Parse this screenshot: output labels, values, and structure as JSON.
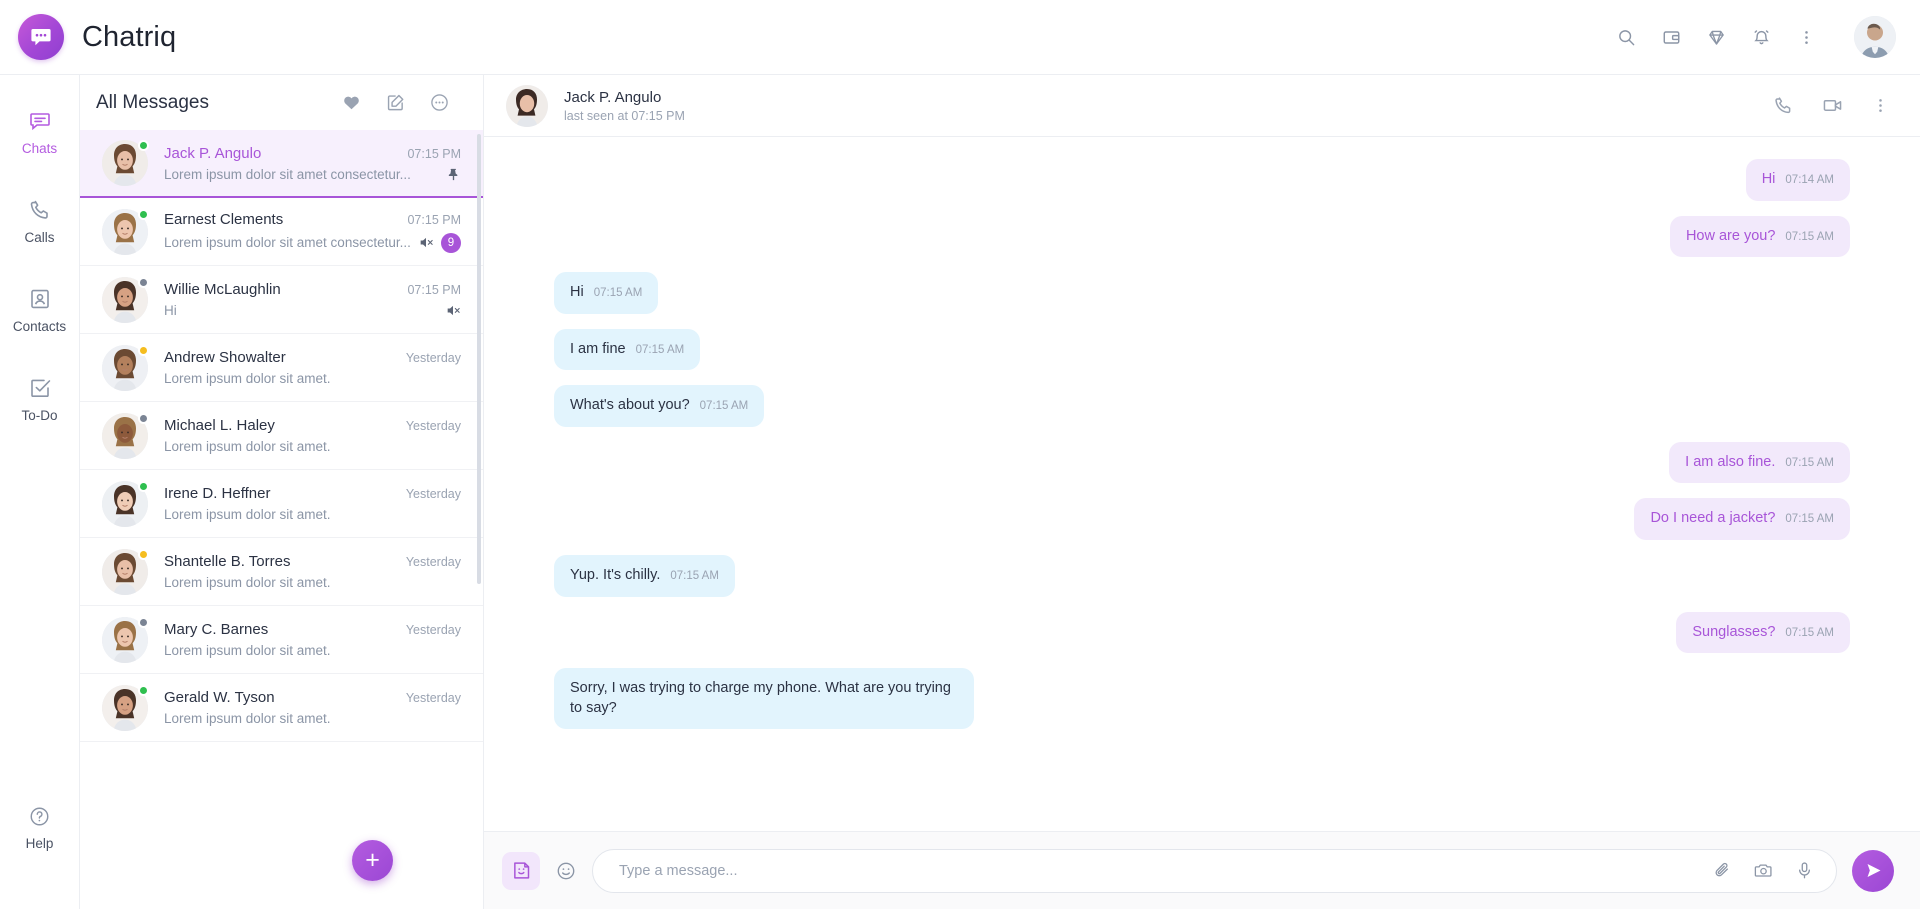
{
  "app": {
    "brand_name": "Chatriq",
    "logo_icon": "chat-bubble-dots-icon"
  },
  "topbar": {
    "icons": [
      {
        "name": "search-icon",
        "label": "Search"
      },
      {
        "name": "wallet-icon",
        "label": "Wallet"
      },
      {
        "name": "diamond-icon",
        "label": "Premium"
      },
      {
        "name": "bell-icon",
        "label": "Notifications"
      },
      {
        "name": "more-vertical-icon",
        "label": "More options"
      }
    ],
    "avatar": "user-avatar"
  },
  "sidebar": {
    "items": [
      {
        "label": "Chats",
        "icon": "chats-icon",
        "active": true
      },
      {
        "label": "Calls",
        "icon": "phone-icon",
        "active": false
      },
      {
        "label": "Contacts",
        "icon": "contact-card-icon",
        "active": false
      },
      {
        "label": "To-Do",
        "icon": "checkbox-icon",
        "active": false
      }
    ],
    "help": {
      "label": "Help",
      "icon": "help-circle-icon"
    }
  },
  "chat_list": {
    "title": "All Messages",
    "actions": [
      {
        "name": "favorites-heart-icon",
        "label": "Favorites"
      },
      {
        "name": "compose-icon",
        "label": "New message"
      },
      {
        "name": "more-circle-icon",
        "label": "More"
      }
    ],
    "new_chat_button": "+",
    "rows": [
      {
        "name": "Jack P. Angulo",
        "time": "07:15 PM",
        "preview": "Lorem ipsum dolor sit amet consectetur...",
        "status": "online",
        "active": true,
        "pinned": true,
        "muted": false,
        "unread": ""
      },
      {
        "name": "Earnest Clements",
        "time": "07:15 PM",
        "preview": "Lorem ipsum dolor sit amet consectetur...",
        "status": "online",
        "active": false,
        "pinned": false,
        "muted": true,
        "unread": "9"
      },
      {
        "name": "Willie McLaughlin",
        "time": "07:15 PM",
        "preview": "Hi",
        "status": "offline",
        "active": false,
        "pinned": false,
        "muted": true,
        "unread": ""
      },
      {
        "name": "Andrew Showalter",
        "time": "Yesterday",
        "preview": "Lorem ipsum dolor sit amet.",
        "status": "away",
        "active": false,
        "pinned": false,
        "muted": false,
        "unread": ""
      },
      {
        "name": "Michael L. Haley",
        "time": "Yesterday",
        "preview": "Lorem ipsum dolor sit amet.",
        "status": "offline",
        "active": false,
        "pinned": false,
        "muted": false,
        "unread": ""
      },
      {
        "name": "Irene D. Heffner",
        "time": "Yesterday",
        "preview": "Lorem ipsum dolor sit amet.",
        "status": "online",
        "active": false,
        "pinned": false,
        "muted": false,
        "unread": ""
      },
      {
        "name": "Shantelle B. Torres",
        "time": "Yesterday",
        "preview": "Lorem ipsum dolor sit amet.",
        "status": "away",
        "active": false,
        "pinned": false,
        "muted": false,
        "unread": ""
      },
      {
        "name": "Mary C. Barnes",
        "time": "Yesterday",
        "preview": "Lorem ipsum dolor sit amet.",
        "status": "offline",
        "active": false,
        "pinned": false,
        "muted": false,
        "unread": ""
      },
      {
        "name": "Gerald W. Tyson",
        "time": "Yesterday",
        "preview": "Lorem ipsum dolor sit amet.",
        "status": "online",
        "active": false,
        "pinned": false,
        "muted": false,
        "unread": ""
      }
    ]
  },
  "conversation": {
    "contact_name": "Jack P. Angulo",
    "status_text": "last seen at 07:15 PM",
    "actions": [
      {
        "name": "call-icon",
        "label": "Voice call"
      },
      {
        "name": "video-icon",
        "label": "Video call"
      },
      {
        "name": "more-vertical-icon",
        "label": "More"
      }
    ],
    "messages": [
      {
        "text": "Hi",
        "time": "07:14 AM",
        "direction": "out"
      },
      {
        "text": "How are you?",
        "time": "07:15 AM",
        "direction": "out"
      },
      {
        "text": "Hi",
        "time": "07:15 AM",
        "direction": "in"
      },
      {
        "text": "I am fine",
        "time": "07:15 AM",
        "direction": "in"
      },
      {
        "text": "What's about you?",
        "time": "07:15 AM",
        "direction": "in"
      },
      {
        "text": "I am also fine.",
        "time": "07:15 AM",
        "direction": "out"
      },
      {
        "text": "Do I need a jacket?",
        "time": "07:15 AM",
        "direction": "out"
      },
      {
        "text": "Yup. It's chilly.",
        "time": "07:15 AM",
        "direction": "in"
      },
      {
        "text": "Sunglasses?",
        "time": "07:15 AM",
        "direction": "out"
      },
      {
        "text": "Sorry, I was trying to charge my phone. What are you trying to say?",
        "time": "",
        "direction": "in"
      }
    ]
  },
  "composer": {
    "sticker_icon": "sticker-icon",
    "emoji_icon": "emoji-smiley-icon",
    "placeholder": "Type a message...",
    "value": "",
    "icons": [
      {
        "name": "attachment-clip-icon",
        "label": "Attach file"
      },
      {
        "name": "camera-icon",
        "label": "Camera"
      },
      {
        "name": "microphone-icon",
        "label": "Voice message"
      }
    ],
    "send_icon": "send-plane-icon"
  },
  "colors": {
    "accent": "#a855d8",
    "incoming_bubble": "#e2f4fd",
    "outgoing_bubble": "#f2e9fb",
    "online": "#2fbf4f",
    "away": "#f5bd1f",
    "offline": "#7b8494"
  }
}
